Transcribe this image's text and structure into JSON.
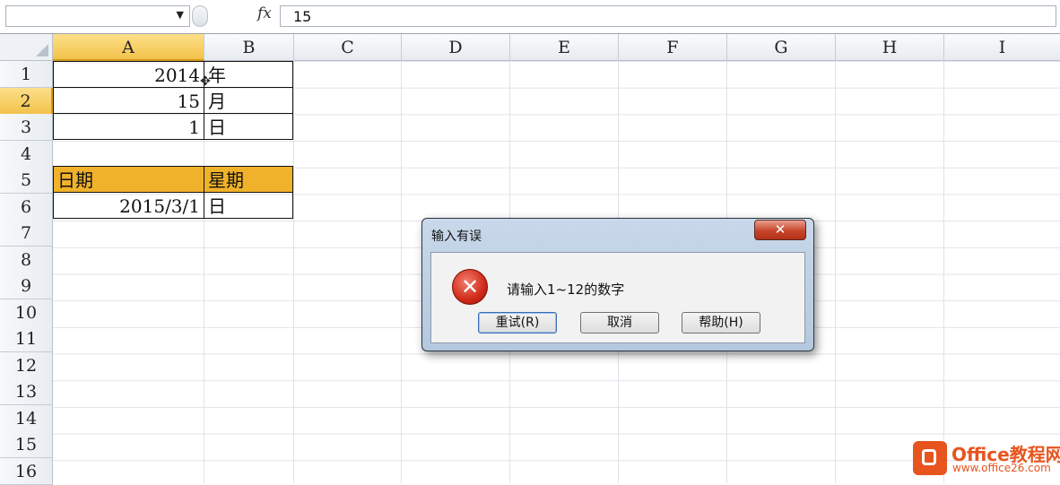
{
  "formula_bar": {
    "name_box": "",
    "fx": "fx",
    "value": "15"
  },
  "columns": [
    "A",
    "B",
    "C",
    "D",
    "E",
    "F",
    "G",
    "H",
    "I"
  ],
  "selected_column": "A",
  "rows": [
    "1",
    "2",
    "3",
    "4",
    "5",
    "6",
    "7",
    "8",
    "9",
    "10",
    "11",
    "12",
    "13",
    "14",
    "15",
    "16"
  ],
  "selected_row": "2",
  "cells": {
    "a1": "2014",
    "b1": "年",
    "a2": "15",
    "b2": "月",
    "a3": "1",
    "b3": "日",
    "a5": "日期",
    "b5": "星期",
    "a6": "2015/3/1",
    "b6": "日"
  },
  "colors": {
    "header_fill": "#f0b22a",
    "selected_header": "#f5c544",
    "error_red": "#d02a1a"
  },
  "dialog": {
    "title": "输入有误",
    "close": "✕",
    "icon": "error-icon",
    "message": "请输入1~12的数字",
    "buttons": {
      "retry": "重试(R)",
      "cancel": "取消",
      "help": "帮助(H)"
    }
  },
  "watermark": {
    "name": "Office教程网",
    "url": "www.office26.com"
  }
}
